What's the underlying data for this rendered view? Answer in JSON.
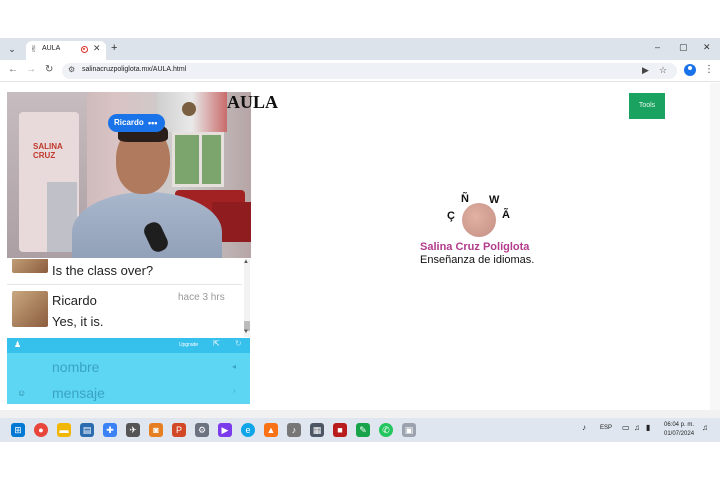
{
  "browser": {
    "tab_title": "AULA",
    "tab_favicon": "✌",
    "new_tab": "+",
    "url": "salinacruzpoliglota.mx/AULA.html",
    "window_controls": [
      "–",
      "▢",
      "✕"
    ]
  },
  "page": {
    "title": "AULA",
    "tools_label": "Tools",
    "video": {
      "participant_name": "Ricardo",
      "menu": "•••",
      "poster_text": "SALINA CRUZ"
    }
  },
  "chat": {
    "messages": [
      {
        "name": "",
        "text": "Is the class over?",
        "time": ""
      },
      {
        "name": "Ricardo",
        "text": "Yes, it is.",
        "time": "hace 3 hrs"
      }
    ],
    "form": {
      "upgrade": "Upgrade",
      "name_placeholder": "nombre",
      "message_placeholder": "mensaje"
    }
  },
  "brand": {
    "letters": [
      "Ñ",
      "W",
      "Ç",
      "Ã"
    ],
    "name": "Salina Cruz Políglota",
    "tagline": "Enseñanza de idiomas."
  },
  "taskbar": {
    "language": "ESP",
    "time": "06:04 p. m.",
    "date": "01/07/2024"
  },
  "colors": {
    "accent": "#1a73e8",
    "tools": "#1aa260",
    "chat_form": "#5dd6f3",
    "brand": "#b23b8c"
  }
}
